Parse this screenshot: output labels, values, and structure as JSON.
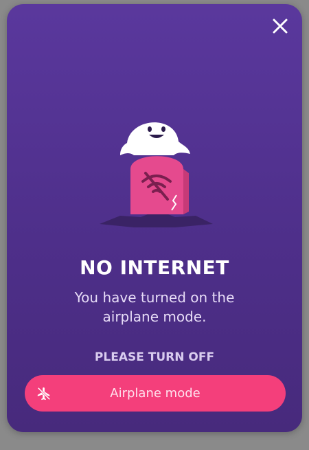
{
  "dialog": {
    "close_icon": "close-icon",
    "illustration": "ghost-tombstone-no-wifi",
    "title": "NO INTERNET",
    "message": "You have turned on the airplane mode.",
    "prompt": "PLEASE TURN OFF",
    "button": {
      "icon": "airplane-off-icon",
      "label": "Airplane mode"
    },
    "colors": {
      "background_top": "#5a389d",
      "background_bottom": "#472a7c",
      "accent": "#f43f7b",
      "tombstone": "#e54a8e"
    }
  }
}
